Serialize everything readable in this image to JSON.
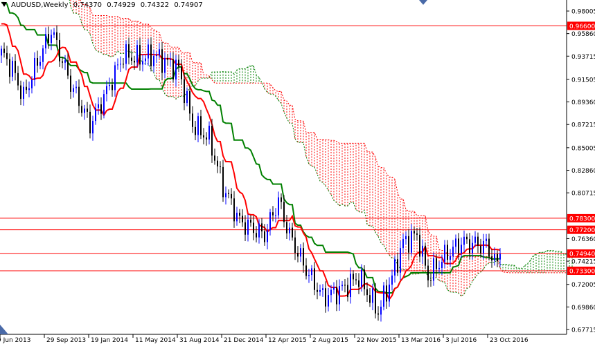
{
  "header": {
    "symbol": "AUDUSD,Weekly",
    "open": "0.74370",
    "high": "0.74929",
    "low": "0.74322",
    "close": "0.74907"
  },
  "colors": {
    "bull": "#0000ff",
    "bear": "#000000",
    "tenkan": "#ff0000",
    "kijun": "#008000",
    "cloud_bear": "#ff0000",
    "cloud_bull": "#008000",
    "level_line": "#ff0000"
  },
  "chart_data": {
    "type": "candlestick",
    "title": "AUDUSD,Weekly",
    "indicator": "Ichimoku Kinko Hyo",
    "ylim": [
      0.6715,
      0.985
    ],
    "y_ticks": [
      "0.98005",
      "0.95860",
      "0.93715",
      "0.91505",
      "0.89360",
      "0.87215",
      "0.85005",
      "0.82860",
      "0.80715",
      "0.76360",
      "0.74215",
      "0.72005",
      "0.69860",
      "0.67715"
    ],
    "x_ticks": [
      {
        "week": 0,
        "label": "9 Jun 2013"
      },
      {
        "week": 16,
        "label": "29 Sep 2013"
      },
      {
        "week": 32,
        "label": "19 Jan 2014"
      },
      {
        "week": 48,
        "label": "11 May 2014"
      },
      {
        "week": 64,
        "label": "31 Aug 2014"
      },
      {
        "week": 80,
        "label": "21 Dec 2014"
      },
      {
        "week": 96,
        "label": "12 Apr 2015"
      },
      {
        "week": 112,
        "label": "2 Aug 2015"
      },
      {
        "week": 128,
        "label": "22 Nov 2015"
      },
      {
        "week": 144,
        "label": "13 Mar 2016"
      },
      {
        "week": 160,
        "label": "3 Jul 2016"
      },
      {
        "week": 176,
        "label": "23 Oct 2016"
      }
    ],
    "levels": [
      {
        "price": 0.966,
        "label": "0.96600"
      },
      {
        "price": 0.783,
        "label": "0.78300"
      },
      {
        "price": 0.772,
        "label": "0.77200"
      },
      {
        "price": 0.7494,
        "label": "0.74940"
      },
      {
        "price": 0.733,
        "label": "0.73300"
      }
    ],
    "price_path_week_close": [
      [
        -40,
        1.045
      ],
      [
        -20,
        1.03
      ],
      [
        -8,
        1.0
      ],
      [
        -3,
        0.97
      ],
      [
        0,
        0.94
      ],
      [
        4,
        0.925
      ],
      [
        8,
        0.898
      ],
      [
        12,
        0.925
      ],
      [
        18,
        0.962
      ],
      [
        25,
        0.911
      ],
      [
        32,
        0.872
      ],
      [
        37,
        0.898
      ],
      [
        44,
        0.938
      ],
      [
        50,
        0.935
      ],
      [
        55,
        0.938
      ],
      [
        64,
        0.925
      ],
      [
        69,
        0.872
      ],
      [
        75,
        0.859
      ],
      [
        80,
        0.813
      ],
      [
        86,
        0.78
      ],
      [
        95,
        0.767
      ],
      [
        100,
        0.8
      ],
      [
        104,
        0.767
      ],
      [
        110,
        0.734
      ],
      [
        116,
        0.708
      ],
      [
        122,
        0.714
      ],
      [
        129,
        0.727
      ],
      [
        136,
        0.694
      ],
      [
        141,
        0.727
      ],
      [
        145,
        0.76
      ],
      [
        150,
        0.767
      ],
      [
        154,
        0.727
      ],
      [
        160,
        0.747
      ],
      [
        166,
        0.76
      ],
      [
        175,
        0.757
      ],
      [
        179,
        0.738
      ],
      [
        180,
        0.74907
      ]
    ]
  }
}
